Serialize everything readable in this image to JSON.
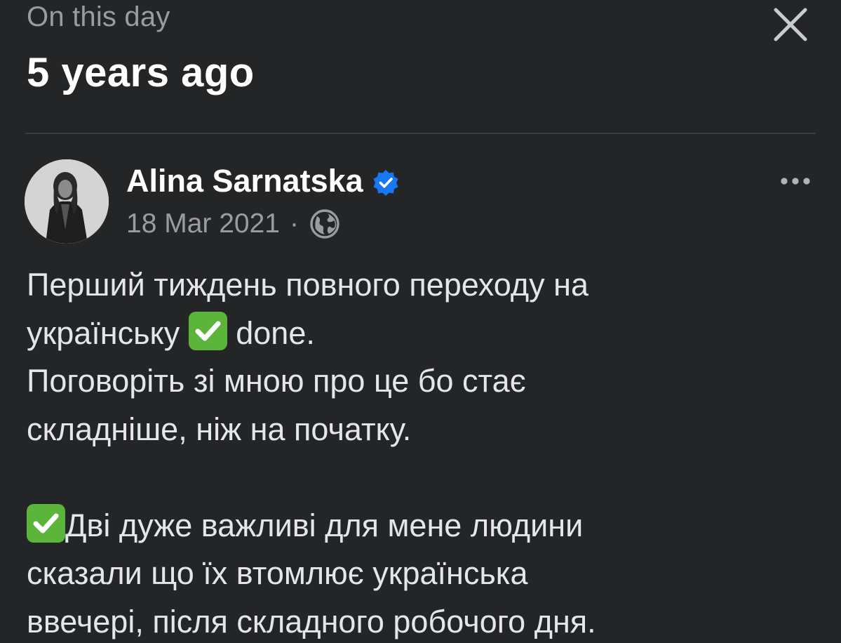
{
  "header": {
    "subtitle": "On this day",
    "title": "5 years ago",
    "close_icon": "close-icon"
  },
  "post": {
    "author": "Alina Sarnatska",
    "verified_icon": "verified-badge-icon",
    "date": "18 Mar 2021",
    "separator": "·",
    "audience_icon": "globe-icon",
    "more_icon": "more-options-icon",
    "lines": {
      "l1": "Перший тиждень повного переходу на",
      "l2a": "українську ",
      "l2b": " done.",
      "l3": "Поговоріть зі мною про це бо стає",
      "l4": "складніше, ніж на початку.",
      "l5": "Дві дуже важливі для мене людини",
      "l6": "сказали що їх втомлює українська",
      "l7": "ввечері, після складного робочого дня."
    },
    "emoji": "✅"
  },
  "colors": {
    "background": "#242526",
    "text_primary": "#ffffff",
    "text_secondary": "#9a9ca1",
    "verified_blue": "#1877f2",
    "check_green": "#5bb53a"
  }
}
